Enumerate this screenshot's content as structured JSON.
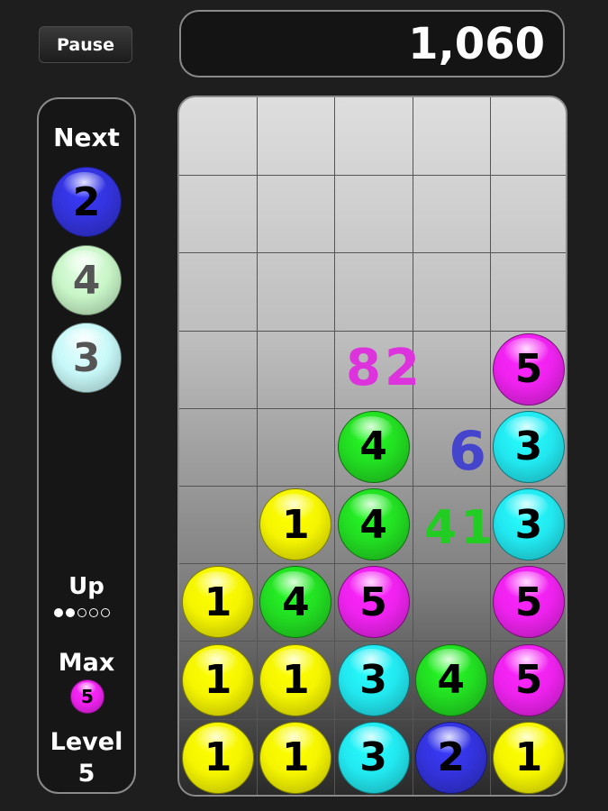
{
  "pause_label": "Pause",
  "score": "1,060",
  "side": {
    "next_label": "Next",
    "next_balls": [
      {
        "value": "2",
        "color": "blue"
      },
      {
        "value": "4",
        "color": "lightgreen"
      },
      {
        "value": "3",
        "color": "lightcyan"
      }
    ],
    "up_label": "Up",
    "up_progress": {
      "filled": 2,
      "total": 5
    },
    "max_label": "Max",
    "max_ball": {
      "value": "5",
      "color": "magenta"
    },
    "level_label": "Level",
    "level_value": "5"
  },
  "palette": {
    "yellow": "#f5f500",
    "green": "#22dd22",
    "cyan": "#22e8f0",
    "magenta": "#ee22ee",
    "blue": "#3333dd",
    "lightgreen": "#c8f5c8",
    "lightcyan": "#c8f8f8"
  },
  "board": {
    "rows": 9,
    "cols": 5,
    "balls": [
      {
        "row": 3,
        "col": 4,
        "value": "5",
        "color": "magenta"
      },
      {
        "row": 4,
        "col": 2,
        "value": "4",
        "color": "green"
      },
      {
        "row": 4,
        "col": 4,
        "value": "3",
        "color": "cyan"
      },
      {
        "row": 5,
        "col": 1,
        "value": "1",
        "color": "yellow"
      },
      {
        "row": 5,
        "col": 2,
        "value": "4",
        "color": "green"
      },
      {
        "row": 5,
        "col": 4,
        "value": "3",
        "color": "cyan"
      },
      {
        "row": 6,
        "col": 0,
        "value": "1",
        "color": "yellow"
      },
      {
        "row": 6,
        "col": 1,
        "value": "4",
        "color": "green"
      },
      {
        "row": 6,
        "col": 2,
        "value": "5",
        "color": "magenta"
      },
      {
        "row": 6,
        "col": 4,
        "value": "5",
        "color": "magenta"
      },
      {
        "row": 7,
        "col": 0,
        "value": "1",
        "color": "yellow"
      },
      {
        "row": 7,
        "col": 1,
        "value": "1",
        "color": "yellow"
      },
      {
        "row": 7,
        "col": 2,
        "value": "3",
        "color": "cyan"
      },
      {
        "row": 7,
        "col": 3,
        "value": "4",
        "color": "green"
      },
      {
        "row": 7,
        "col": 4,
        "value": "5",
        "color": "magenta"
      },
      {
        "row": 8,
        "col": 0,
        "value": "1",
        "color": "yellow"
      },
      {
        "row": 8,
        "col": 1,
        "value": "1",
        "color": "yellow"
      },
      {
        "row": 8,
        "col": 2,
        "value": "3",
        "color": "cyan"
      },
      {
        "row": 8,
        "col": 3,
        "value": "2",
        "color": "blue"
      },
      {
        "row": 8,
        "col": 4,
        "value": "1",
        "color": "yellow"
      }
    ],
    "score_popups": [
      {
        "text": "82",
        "color": "#dd33dd"
      },
      {
        "text": "6",
        "color": "#4444cc"
      },
      {
        "text": "41",
        "color": "#22cc22"
      }
    ]
  }
}
